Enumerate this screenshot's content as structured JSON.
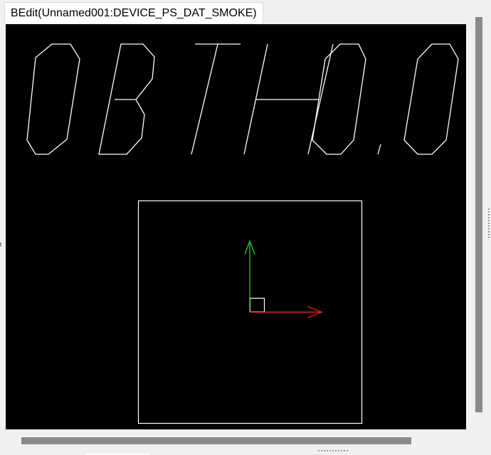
{
  "window": {
    "tab_title": "BEdit(Unnamed001:DEVICE_PS_DAT_SMOKE)"
  },
  "canvas": {
    "background": "#000000",
    "glyph_text": "0BTH0.0",
    "stroke_color": "#ffffff",
    "axis_x_color": "#e02020",
    "axis_y_color": "#20c020"
  }
}
